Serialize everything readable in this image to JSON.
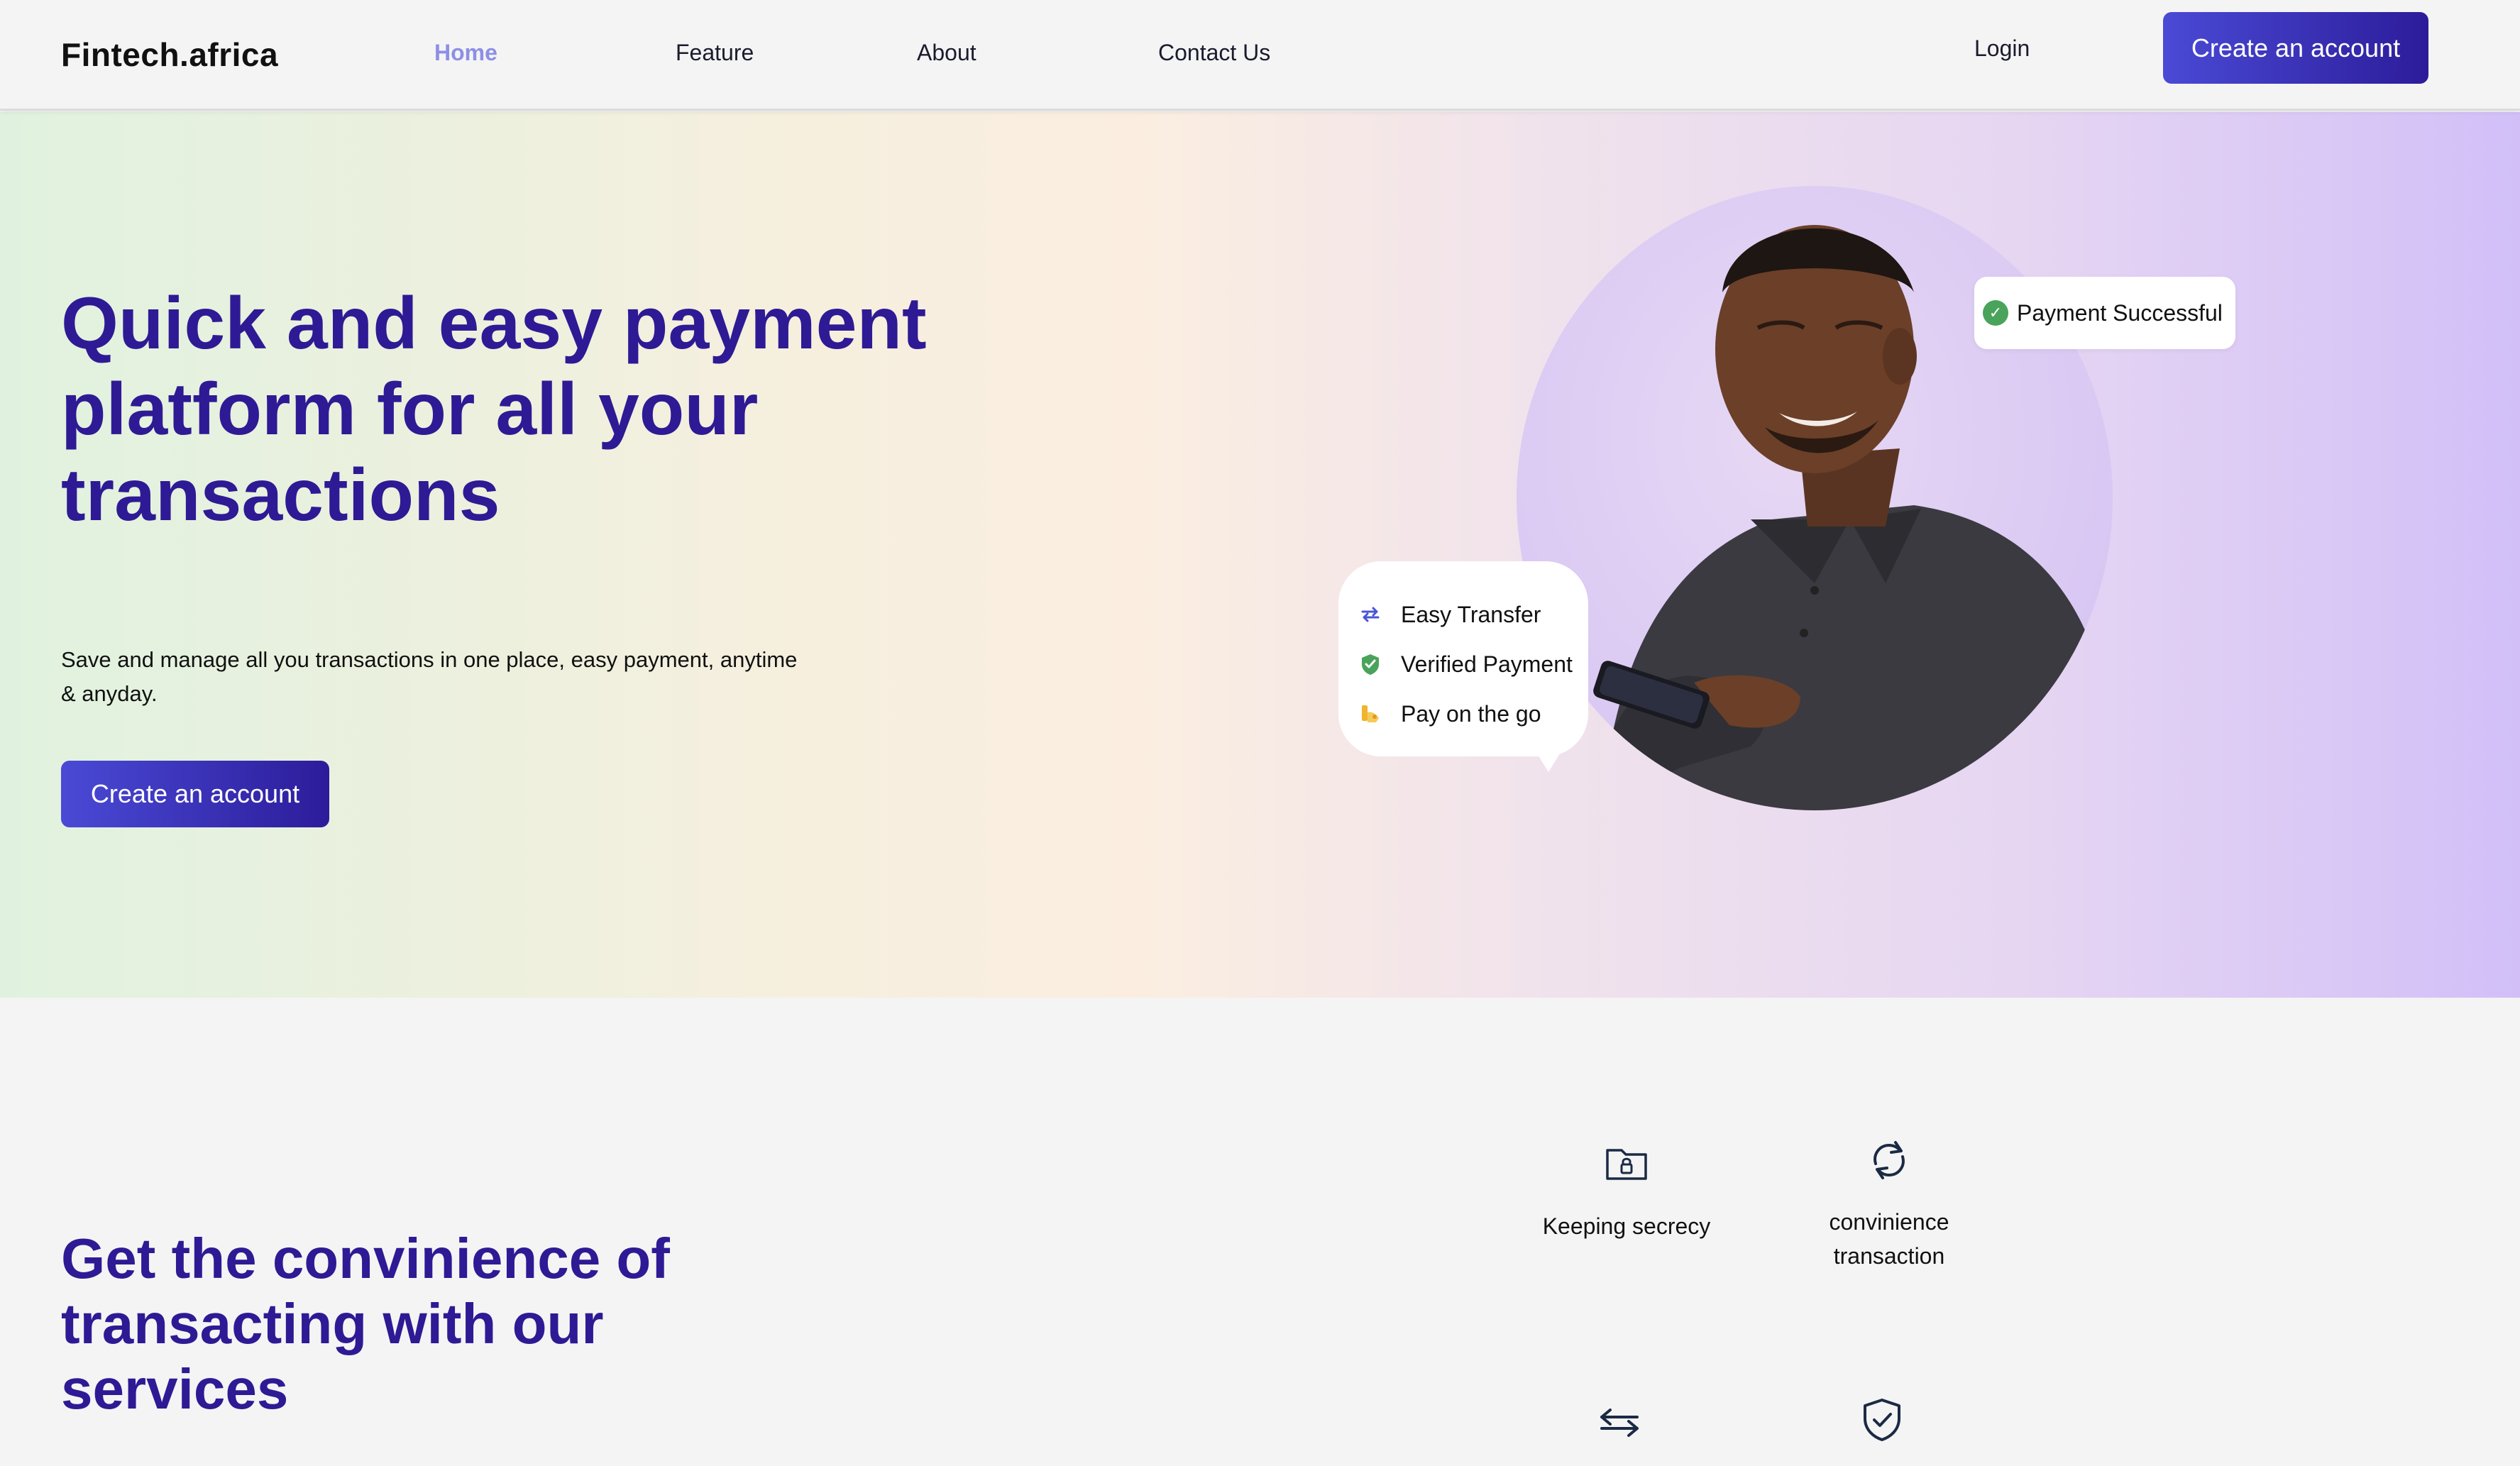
{
  "nav": {
    "brand": "Fintech.africa",
    "links": [
      {
        "label": "Home",
        "active": true
      },
      {
        "label": "Feature",
        "active": false
      },
      {
        "label": "About",
        "active": false
      },
      {
        "label": "Contact Us",
        "active": false
      }
    ],
    "login_label": "Login",
    "cta_label": "Create an account"
  },
  "hero": {
    "title": "Quick and easy payment platform for all your transactions",
    "subtitle": "Save and manage all you transactions in one place, easy payment, anytime & anyday.",
    "cta_label": "Create an account",
    "success_pill": {
      "label": "Payment Successful",
      "icon": "check-circle-icon",
      "color": "#4aa35a"
    },
    "bubble_items": [
      {
        "label": "Easy Transfer",
        "icon": "transfer-arrows-icon",
        "color": "#4a55d6"
      },
      {
        "label": "Verified Payment",
        "icon": "shield-check-icon",
        "color": "#4aa35a"
      },
      {
        "label": "Pay on the go",
        "icon": "hand-money-icon",
        "color": "#f0b52c"
      }
    ]
  },
  "services": {
    "title": "Get the convinience of transacting with our services",
    "items": [
      {
        "label": "Keeping secrecy",
        "icon": "secure-folder-icon"
      },
      {
        "label": "convinience transaction",
        "icon": "refresh-arrows-icon"
      },
      {
        "label": "",
        "icon": "exchange-arrows-icon"
      },
      {
        "label": "",
        "icon": "shield-check-icon"
      }
    ]
  },
  "colors": {
    "accent": "#2e1a94",
    "button_gradient_start": "#4a4ad6",
    "button_gradient_end": "#2c1c9a",
    "nav_active": "#8d8fe6"
  }
}
